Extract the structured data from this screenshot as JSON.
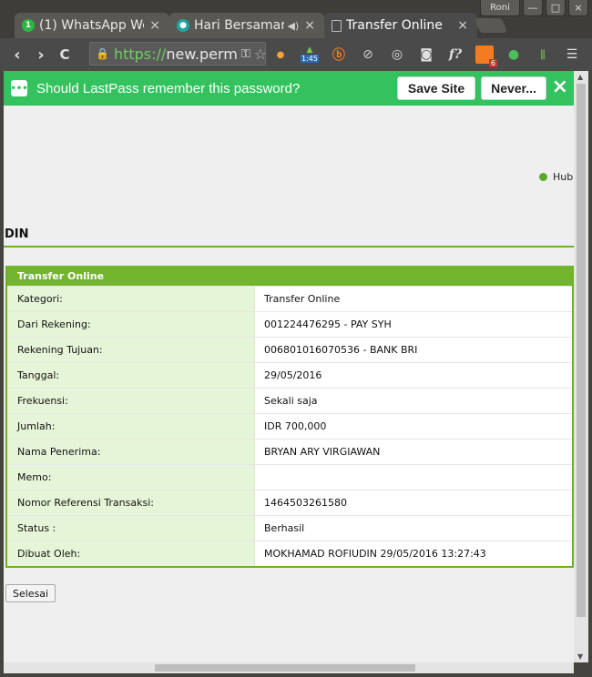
{
  "tabs": [
    {
      "title": "(1) WhatsApp We",
      "icon": "whatsapp-icon",
      "close": "×"
    },
    {
      "title": "Hari Bersamar",
      "icon": "record-icon",
      "close": "×",
      "speaker": "◀)"
    },
    {
      "title": "Transfer Online",
      "icon": "page-icon",
      "close": "×"
    }
  ],
  "window": {
    "profile": "Roni",
    "minimize": "—",
    "maximize": "□",
    "close": "×"
  },
  "toolbar": {
    "back": "‹",
    "forward": "›",
    "reload": "C",
    "url_https": "https://",
    "url_rest": "new.perm",
    "ext_timer_badge": "1:45",
    "ext_hubspot_badge": "6"
  },
  "lastpass": {
    "message": "Should LastPass remember this password?",
    "save_label": "Save Site",
    "never_label": "Never...",
    "close": "×"
  },
  "page": {
    "hub_link": "Hub",
    "section_title": "DIN",
    "table_title": "Transfer Online",
    "rows": [
      {
        "label": "Kategori:",
        "value": "Transfer Online"
      },
      {
        "label": "Dari Rekening:",
        "value": "001224476295 - PAY SYH"
      },
      {
        "label": "Rekening Tujuan:",
        "value": "006801016070536 - BANK BRI"
      },
      {
        "label": "Tanggal:",
        "value": "29/05/2016"
      },
      {
        "label": "Frekuensi:",
        "value": "Sekali saja"
      },
      {
        "label": "Jumlah:",
        "value": "IDR 700,000"
      },
      {
        "label": "Nama Penerima:",
        "value": "BRYAN ARY VIRGIAWAN"
      },
      {
        "label": "Memo:",
        "value": ""
      },
      {
        "label": "Nomor Referensi Transaksi:",
        "value": "1464503261580"
      },
      {
        "label": "Status :",
        "value": "Berhasil"
      },
      {
        "label": "Dibuat Oleh:",
        "value": "MOKHAMAD ROFIUDIN 29/05/2016 13:27:43"
      }
    ],
    "done_label": "Selesai"
  },
  "colors": {
    "lastpass_green": "#33c25e",
    "table_green": "#72b42c",
    "label_bg": "#e6f5d8"
  }
}
